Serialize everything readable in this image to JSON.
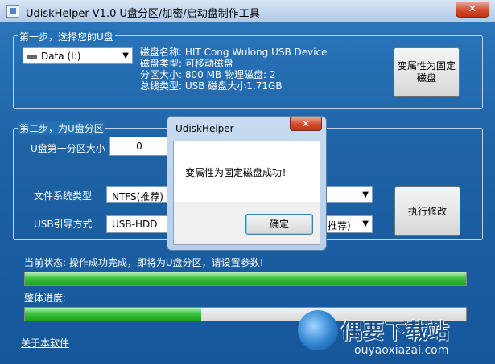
{
  "window": {
    "title": "UdiskHelper V1.0  U盘分区/加密/启动盘制作工具",
    "close_glyph": "✕"
  },
  "step1": {
    "legend": "第一步，选择您的U盘",
    "drive_select": "Data (I:)",
    "info_lines": [
      "磁盘名称: HIT Cong Wulong USB Device",
      "磁盘类型: 可移动磁盘",
      "分区大小: 800 MB  物理磁盘: 2",
      "总线类型: USB   磁盘大小1.71GB"
    ],
    "convert_button": "变属性为固定磁盘"
  },
  "step2": {
    "legend": "第二步，为U盘分区",
    "first_partition_label": "U盘第一分区大小",
    "first_partition_value": "0",
    "fs_label": "文件系统类型",
    "fs_value": "NTFS(推荐)",
    "boot_label": "USB引导方式",
    "boot_value": "USB-HDD",
    "boot_value_tail": "推荐)",
    "apply_button": "执行修改"
  },
  "status": {
    "current_text": "当前状态: 操作成功完成，即将为U盘分区，请设置参数!",
    "current_progress": 1.0,
    "overall_label": "整体进度:",
    "overall_progress": 0.4
  },
  "about_link": "关于本软件",
  "dialog": {
    "title": "UdiskHelper",
    "message": "变属性为固定磁盘成功！",
    "ok_button": "确定",
    "close_glyph": "✕"
  },
  "watermark": {
    "brand": "偶要下载站",
    "url": "ouyaoxiazai.com"
  },
  "colors": {
    "window_bg": "#1e63a6",
    "progress_green": "#3dc33d",
    "close_red": "#d4482d"
  }
}
